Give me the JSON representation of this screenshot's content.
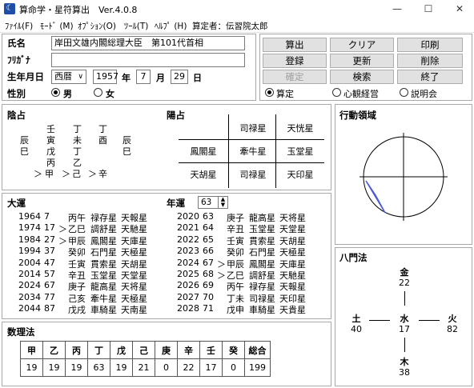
{
  "window": {
    "title": "算命学・星符算出　Ver.4.0.8",
    "minimize": "—",
    "maximize": "☐",
    "close": "✕"
  },
  "menu": {
    "file": "ﾌｧｲﾙ(F)",
    "mode": "ﾓｰﾄﾞ (M)",
    "option": "ｵﾌﾟｼｮﾝ(O)",
    "tool": "ﾂｰﾙ(T)",
    "help": "ﾍﾙﾌﾟ (H)",
    "calculator": "算定者：伝習院太郎"
  },
  "form": {
    "name_label": "氏名",
    "name_value": "岸田文雄内閣総理大臣　第101代首相",
    "kana_label": "ﾌﾘｶﾞﾅ",
    "kana_value": "",
    "birth_label": "生年月日",
    "era": "西暦",
    "year": "1957",
    "year_unit": "年",
    "month": "7",
    "month_unit": "月",
    "day": "29",
    "day_unit": "日",
    "sex_label": "性別",
    "male": "男",
    "female": "女",
    "sex_selected": "male"
  },
  "buttons": {
    "calc": "算出",
    "clear": "クリア",
    "print": "印刷",
    "register": "登録",
    "update": "更新",
    "delete": "削除",
    "confirm": "確定",
    "search": "検索",
    "exit": "終了"
  },
  "modes": {
    "calc": "算定",
    "heart": "心観経営",
    "explain": "説明会",
    "selected": "calc"
  },
  "inyo": {
    "title": "陰占",
    "rows": [
      [
        "",
        "壬",
        "丁",
        "丁",
        ""
      ],
      [
        "辰",
        "寅",
        "未",
        "酉",
        "辰"
      ],
      [
        "巳",
        "戊",
        "丁",
        "",
        "巳"
      ],
      [
        "",
        "丙",
        "乙",
        "",
        ""
      ]
    ],
    "flow": [
      "＞",
      "甲",
      "＞",
      "己",
      "＞",
      "辛"
    ]
  },
  "yosen": {
    "title": "陽占",
    "grid": [
      [
        "",
        "司禄星",
        "天恍星"
      ],
      [
        "鳳閣星",
        "牽牛星",
        "玉堂星"
      ],
      [
        "天胡星",
        "司禄星",
        "天印星"
      ]
    ]
  },
  "kodo": {
    "title": "行動領域"
  },
  "taiun": {
    "title": "大運",
    "rows": [
      [
        "1964",
        "7",
        "",
        "丙午",
        "禄存星",
        "天報星"
      ],
      [
        "1974",
        "17",
        "＞",
        "乙巳",
        "調舒星",
        "天馳星"
      ],
      [
        "1984",
        "27",
        "＞",
        "甲辰",
        "鳳閣星",
        "天庫星"
      ],
      [
        "1994",
        "37",
        "",
        "癸卯",
        "石門星",
        "天極星"
      ],
      [
        "2004",
        "47",
        "",
        "壬寅",
        "貫索星",
        "天胡星"
      ],
      [
        "2014",
        "57",
        "",
        "辛丑",
        "玉堂星",
        "天堂星"
      ],
      [
        "2024",
        "67",
        "",
        "庚子",
        "龍高星",
        "天将星"
      ],
      [
        "2034",
        "77",
        "",
        "己亥",
        "牽牛星",
        "天極星"
      ],
      [
        "2044",
        "87",
        "",
        "戊戌",
        "車騎星",
        "天南星"
      ]
    ]
  },
  "nenun": {
    "title": "年運",
    "age": "63",
    "rows": [
      [
        "2020",
        "63",
        "",
        "庚子",
        "龍高星",
        "天将星"
      ],
      [
        "2021",
        "64",
        "",
        "辛丑",
        "玉堂星",
        "天堂星"
      ],
      [
        "2022",
        "65",
        "",
        "壬寅",
        "貫索星",
        "天胡星"
      ],
      [
        "2023",
        "66",
        "",
        "癸卯",
        "石門星",
        "天極星"
      ],
      [
        "2024",
        "67",
        "＞",
        "甲辰",
        "鳳閣星",
        "天庫星"
      ],
      [
        "2025",
        "68",
        "＞",
        "乙巳",
        "調舒星",
        "天馳星"
      ],
      [
        "2026",
        "69",
        "",
        "丙午",
        "禄存星",
        "天報星"
      ],
      [
        "2027",
        "70",
        "",
        "丁未",
        "司禄星",
        "天印星"
      ],
      [
        "2028",
        "71",
        "",
        "戊申",
        "車騎星",
        "天貴星"
      ]
    ]
  },
  "hachimon": {
    "title": "八門法",
    "kin_label": "金",
    "kin_value": "22",
    "do_label": "土",
    "do_value": "40",
    "sui_label": "水",
    "sui_value": "17",
    "ka_label": "火",
    "ka_value": "82",
    "moku_label": "木",
    "moku_value": "38"
  },
  "suuri": {
    "title": "数理法",
    "headers": [
      "甲",
      "乙",
      "丙",
      "丁",
      "戊",
      "己",
      "庚",
      "辛",
      "壬",
      "癸",
      "総合"
    ],
    "values": [
      "19",
      "19",
      "19",
      "63",
      "19",
      "21",
      "0",
      "22",
      "17",
      "0",
      "199"
    ]
  }
}
